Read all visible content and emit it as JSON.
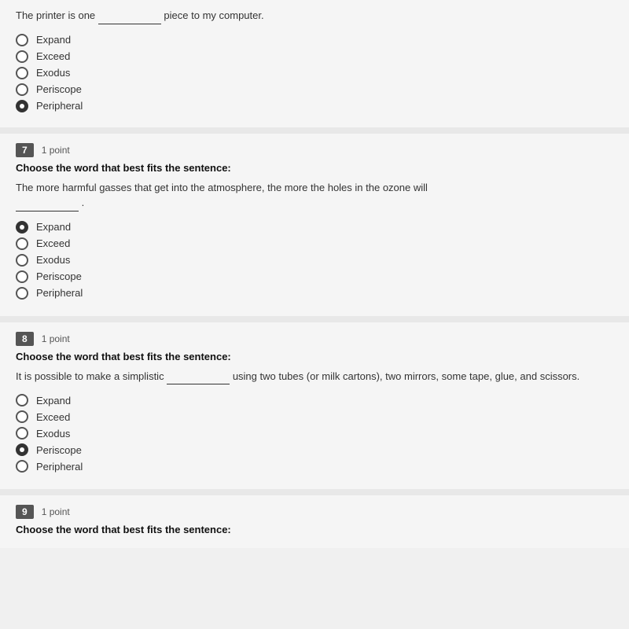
{
  "topSection": {
    "sentence": "The printer is one",
    "sentenceSuffix": " piece to my computer.",
    "options": [
      {
        "label": "Expand",
        "selected": false
      },
      {
        "label": "Exceed",
        "selected": false
      },
      {
        "label": "Exodus",
        "selected": false
      },
      {
        "label": "Periscope",
        "selected": false
      },
      {
        "label": "Peripheral",
        "selected": true
      }
    ]
  },
  "questions": [
    {
      "number": "7",
      "points": "1 point",
      "instruction": "Choose the word that best fits the sentence:",
      "sentence": "The more harmful gasses that get into the atmosphere, the more the holes in the ozone will",
      "sentenceSuffix": "",
      "blankPosition": "end",
      "options": [
        {
          "label": "Expand",
          "selected": true
        },
        {
          "label": "Exceed",
          "selected": false
        },
        {
          "label": "Exodus",
          "selected": false
        },
        {
          "label": "Periscope",
          "selected": false
        },
        {
          "label": "Peripheral",
          "selected": false
        }
      ]
    },
    {
      "number": "8",
      "points": "1 point",
      "instruction": "Choose the word that best fits the sentence:",
      "sentence": "It is possible to make a simplistic",
      "sentenceSuffix": " using two tubes (or milk cartons), two mirrors, some tape, glue, and scissors.",
      "blankPosition": "middle",
      "options": [
        {
          "label": "Expand",
          "selected": false
        },
        {
          "label": "Exceed",
          "selected": false
        },
        {
          "label": "Exodus",
          "selected": false
        },
        {
          "label": "Periscope",
          "selected": true
        },
        {
          "label": "Peripheral",
          "selected": false
        }
      ]
    },
    {
      "number": "9",
      "points": "1 point",
      "instruction": "Choose the word that best fits the sentence:"
    }
  ]
}
